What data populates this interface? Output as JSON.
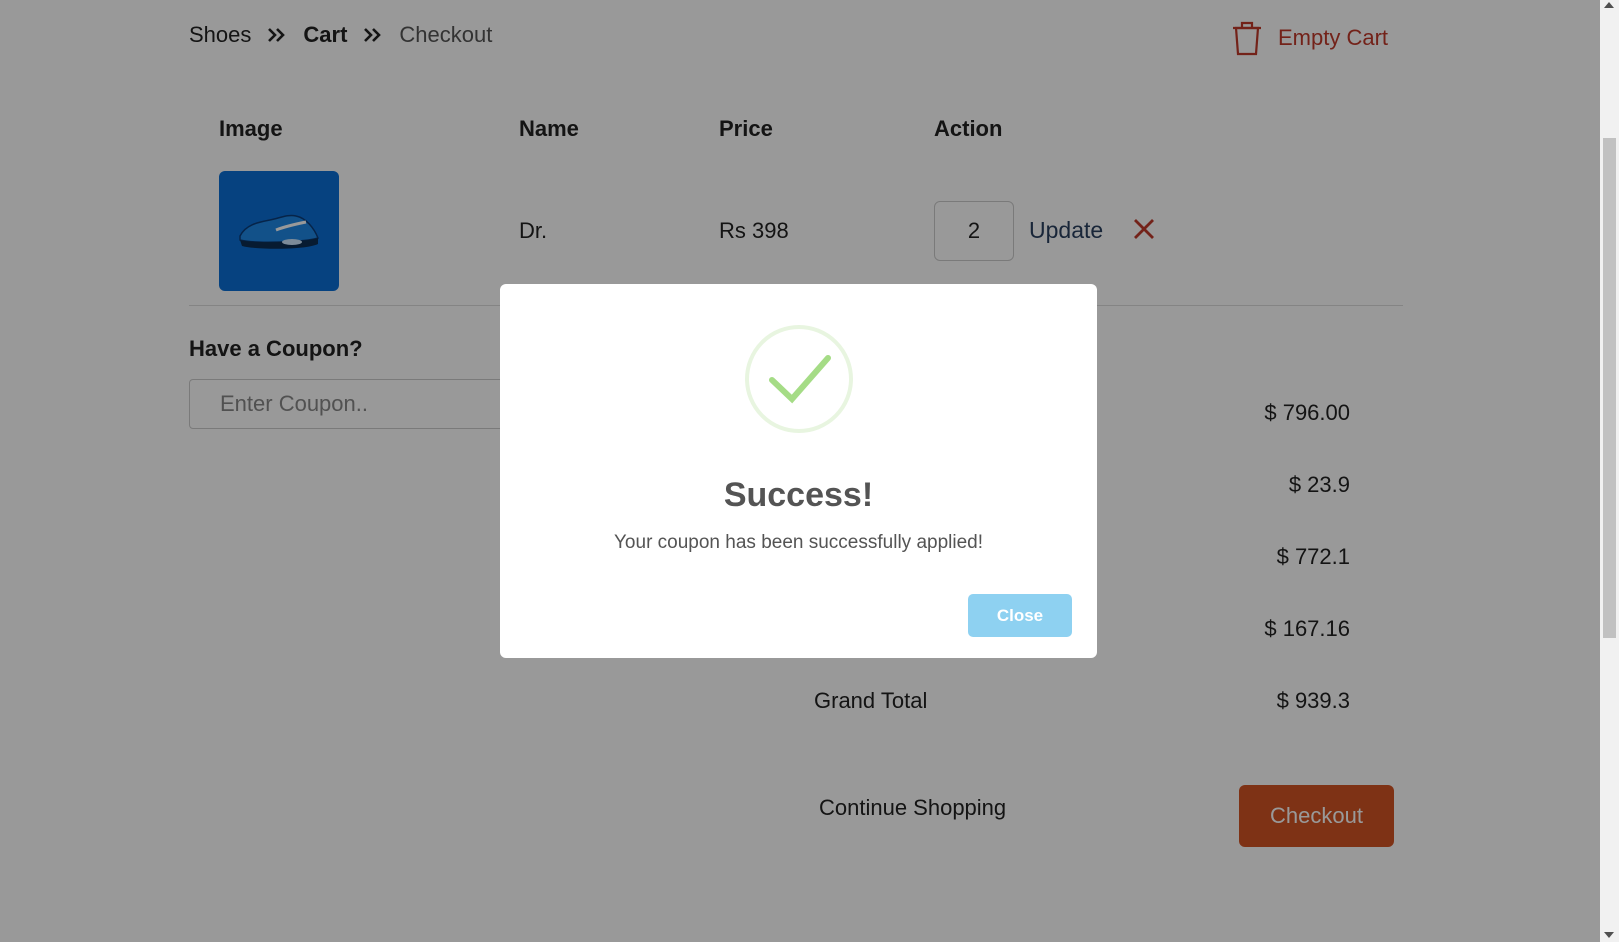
{
  "breadcrumb": {
    "items": [
      "Shoes",
      "Cart",
      "Checkout"
    ]
  },
  "header": {
    "empty_cart_label": "Empty Cart"
  },
  "table": {
    "headers": [
      "Image",
      "Name",
      "Price",
      "Action"
    ],
    "rows": [
      {
        "name": "Dr.",
        "price": "Rs 398",
        "quantity": "2",
        "update_label": "Update"
      }
    ]
  },
  "coupon": {
    "title": "Have a Coupon?",
    "placeholder": "Enter Coupon.."
  },
  "summary": {
    "values": [
      "$ 796.00",
      "$ 23.9",
      "$ 772.1",
      "$ 167.16"
    ],
    "grand_total_label": "Grand Total",
    "grand_total_value": "$ 939.3"
  },
  "actions": {
    "continue_label": "Continue Shopping",
    "checkout_label": "Checkout"
  },
  "modal": {
    "title": "Success!",
    "message": "Your coupon has been successfully applied!",
    "close_label": "Close"
  },
  "colors": {
    "danger": "#c0392b",
    "checkout": "#d35424",
    "close_button": "#8ed1f1",
    "success": "#a5dc86"
  }
}
